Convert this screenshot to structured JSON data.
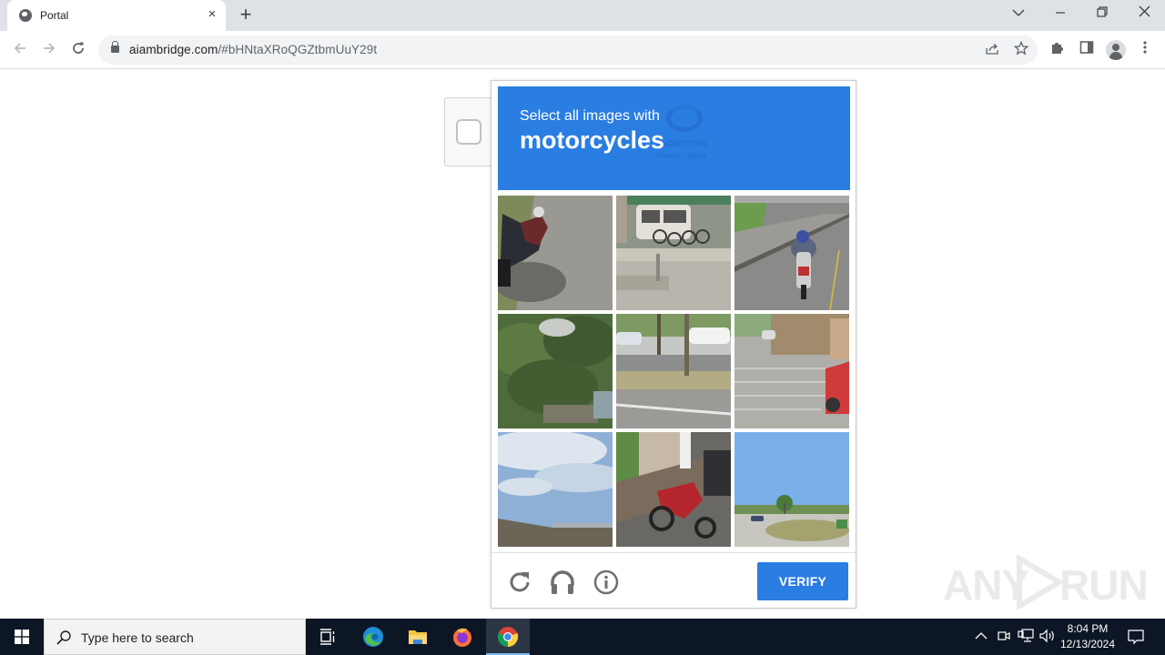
{
  "browser": {
    "tab": {
      "title": "Portal",
      "favicon": "globe-icon",
      "close": "×"
    },
    "new_tab": "+",
    "window_controls": {
      "tab_search": "⌄",
      "minimize": "–",
      "restore": "❐",
      "close": "✕"
    },
    "nav": {
      "back": "←",
      "forward": "→",
      "reload": "↻"
    },
    "url": {
      "domain": "aiambridge.com",
      "rest": "/#bHNtaXRoQGZtbmUuY29t"
    },
    "omnibox_icons": [
      "share-icon",
      "bookmark-star-icon"
    ],
    "toolbar_icons": [
      "extensions-icon",
      "side-panel-icon",
      "profile-avatar-icon",
      "menu-kebab-icon"
    ]
  },
  "page": {
    "recaptcha_anchor": {
      "checkbox_checked": false
    },
    "challenge": {
      "instruction": "Select all images with",
      "target": "motorcycles",
      "header_color": "#2a7de1",
      "tiles": [
        {
          "description": "Parked scooter on road",
          "selected": false
        },
        {
          "description": "Bicycles by van",
          "selected": false
        },
        {
          "description": "Motorcyclist on road",
          "selected": false
        },
        {
          "description": "Trees and bushes",
          "selected": false
        },
        {
          "description": "Street with trees and cars",
          "selected": false
        },
        {
          "description": "Parking lot with red car",
          "selected": false
        },
        {
          "description": "Sky with clouds",
          "selected": false
        },
        {
          "description": "Red motorcycle on sidewalk",
          "selected": false
        },
        {
          "description": "Park with blue sky",
          "selected": false
        }
      ],
      "footer": {
        "reload_icon": "reload-icon",
        "audio_icon": "headphones-icon",
        "info_icon": "info-icon",
        "verify_label": "VERIFY"
      }
    },
    "watermark": {
      "left": "ANY",
      "right": "RUN"
    }
  },
  "taskbar": {
    "search_placeholder": "Type here to search",
    "apps": [
      "task-view",
      "edge",
      "file-explorer",
      "firefox",
      "chrome"
    ],
    "active_app": "chrome",
    "clock": {
      "time": "8:04 PM",
      "date": "12/13/2024"
    }
  }
}
